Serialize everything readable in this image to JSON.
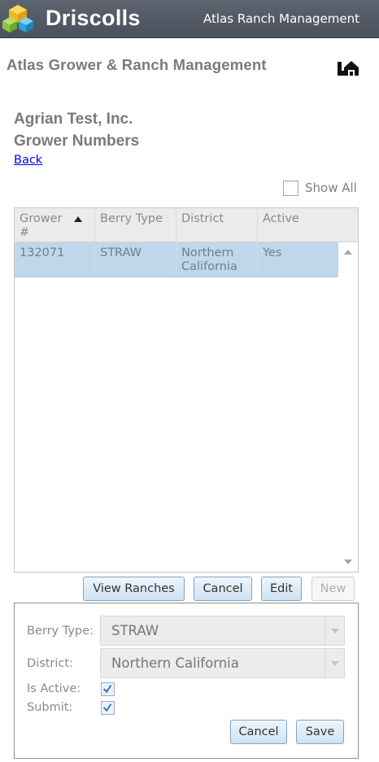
{
  "topbar": {
    "brand": "Driscolls",
    "app_title": "Atlas Ranch Management",
    "logo_icon": "cube-logo-icon",
    "colors": {
      "bar": "#555c67",
      "logo_yellow": "#f6c21c",
      "logo_green": "#8cc63f",
      "logo_blue": "#29a6de"
    }
  },
  "header": {
    "title": "Atlas Grower & Ranch Management",
    "icon": "ranch-logo-icon"
  },
  "page": {
    "org_name": "Agrian Test, Inc.",
    "section_title": "Grower Numbers",
    "back_label": "Back",
    "show_all_label": "Show All",
    "show_all_checked": false
  },
  "grid": {
    "columns": [
      {
        "label": "Grower #",
        "sorted": "ascending"
      },
      {
        "label": "Berry Type"
      },
      {
        "label": "District"
      },
      {
        "label": "Active"
      }
    ],
    "rows": [
      {
        "grower": "132071",
        "berry_type": "STRAW",
        "district": "Northern California",
        "active": "Yes",
        "selected": true
      }
    ],
    "selected_row_color": "#bfd7eb"
  },
  "actions": {
    "view_ranches": "View Ranches",
    "cancel": "Cancel",
    "edit": "Edit",
    "new": "New",
    "new_disabled": true
  },
  "detail": {
    "berry_type_label": "Berry Type:",
    "berry_type_value": "STRAW",
    "district_label": "District:",
    "district_value": "Northern California",
    "is_active_label": "Is Active:",
    "is_active_checked": true,
    "submit_label": "Submit:",
    "submit_checked": true,
    "cancel_label": "Cancel",
    "save_label": "Save"
  }
}
